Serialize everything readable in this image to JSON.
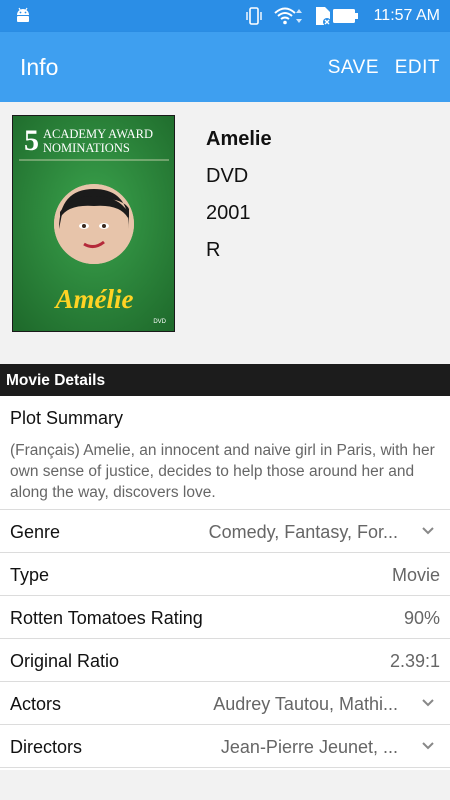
{
  "status_bar": {
    "time": "11:57 AM",
    "icons": [
      "android-icon",
      "vibrate-icon",
      "wifi-icon",
      "sd-card-icon",
      "battery-icon"
    ]
  },
  "app_bar": {
    "title": "Info",
    "save_label": "SAVE",
    "edit_label": "EDIT",
    "color": "#3e9ff0"
  },
  "poster": {
    "award_number": "5",
    "award_line1": "ACADEMY AWARD",
    "award_line2": "NOMINATIONS",
    "movie_name": "Amélie",
    "format_mark": "DVD"
  },
  "movie": {
    "title": "Amelie",
    "format": "DVD",
    "year": "2001",
    "rating": "R"
  },
  "details": {
    "section_title": "Movie Details",
    "plot_label": "Plot Summary",
    "plot_text": "(Français) Amelie, an innocent and naive girl in Paris, with her own sense of justice, decides to help those around her and along the way, discovers love.",
    "rows": [
      {
        "label": "Genre",
        "value": "Comedy, Fantasy, For...",
        "dropdown": true
      },
      {
        "label": "Type",
        "value": "Movie",
        "dropdown": false
      },
      {
        "label": "Rotten Tomatoes Rating",
        "value": "90%",
        "dropdown": false
      },
      {
        "label": "Original Ratio",
        "value": "2.39:1",
        "dropdown": false
      },
      {
        "label": "Actors",
        "value": "Audrey Tautou, Mathi...",
        "dropdown": true
      },
      {
        "label": "Directors",
        "value": "Jean-Pierre Jeunet, ...",
        "dropdown": true
      }
    ]
  }
}
